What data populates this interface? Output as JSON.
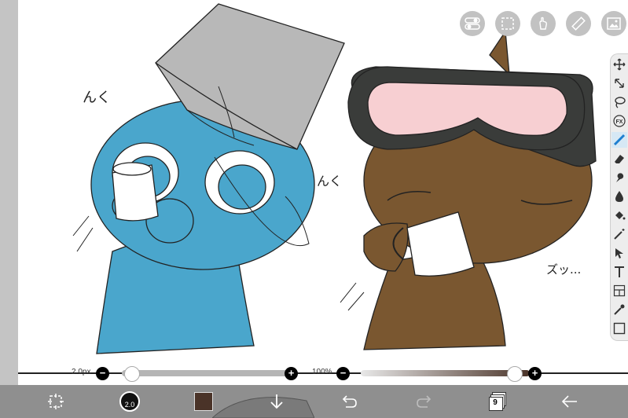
{
  "slider_bar": {
    "brush_size_label": "2.0px",
    "brush_size_minus": "−",
    "brush_size_plus": "+",
    "brush_size_fraction": 0.0,
    "opacity_label": "100%",
    "opacity_minus": "−",
    "opacity_plus": "+",
    "opacity_fraction": 1.0
  },
  "bottom_bar": {
    "brush_size_value": "2.0",
    "current_color": "#4a3328",
    "layer_count": "9"
  },
  "canvas": {
    "text_left": "んく",
    "text_middle": "んく",
    "text_right": "ズッ...",
    "colors": {
      "blue_character": "#4aa6cc",
      "brown_character": "#7a5730",
      "bucket": "#b8b8b8",
      "goggle_lens": "#f7cfd2",
      "goggle_frame": "#3a3c3a"
    }
  },
  "top_tools": [
    "toggle-icon",
    "selection-icon",
    "hand-icon",
    "ruler-icon",
    "image-icon"
  ],
  "side_tools": [
    "move-icon",
    "transform-icon",
    "lasso-icon",
    "fx-icon",
    "pen-icon",
    "eraser-icon",
    "smudge-icon",
    "blur-icon",
    "bucket-icon",
    "magic-wand-icon",
    "select-icon",
    "text-icon",
    "frame-divider-icon",
    "eyedropper-icon",
    "canvas-icon"
  ]
}
